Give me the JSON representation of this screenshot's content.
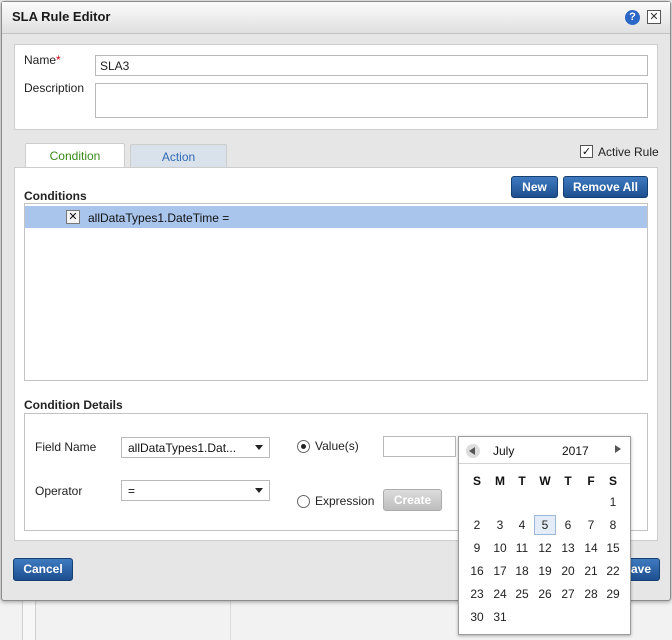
{
  "dialog": {
    "title": "SLA Rule Editor"
  },
  "form": {
    "name_label": "Name",
    "required_mark": "*",
    "name_value": "SLA3",
    "description_label": "Description",
    "description_value": ""
  },
  "tabs": [
    {
      "label": "Condition",
      "active": true
    },
    {
      "label": "Action",
      "active": false
    }
  ],
  "active_rule": {
    "label": "Active Rule",
    "checked": true
  },
  "conditions": {
    "title": "Conditions",
    "new_label": "New",
    "remove_all_label": "Remove All",
    "items": [
      {
        "text": "allDataTypes1.DateTime ="
      }
    ]
  },
  "details": {
    "title": "Condition Details",
    "field_name_label": "Field Name",
    "field_name_value": "allDataTypes1.Dat...",
    "operator_label": "Operator",
    "operator_value": "=",
    "values_label": "Value(s)",
    "value_input": "",
    "expression_label": "Expression",
    "create_label": "Create",
    "selected_mode": "values"
  },
  "calendar": {
    "month": "July",
    "year": "2017",
    "weekdays": [
      "S",
      "M",
      "T",
      "W",
      "T",
      "F",
      "S"
    ],
    "first_weekday_index": 6,
    "days_in_month": 31,
    "selected_day": 5
  },
  "footer": {
    "cancel_label": "Cancel",
    "save_label": "ave"
  },
  "colors": {
    "accent": "#1d4f8f",
    "selected_row": "#a9c5ec",
    "tab_active_text": "#3a8a1a",
    "tab_inactive_text": "#3069b5"
  }
}
